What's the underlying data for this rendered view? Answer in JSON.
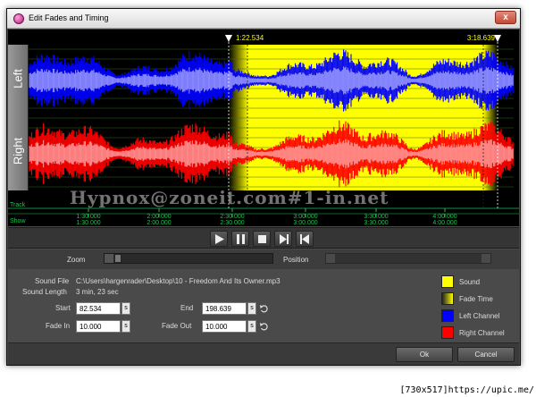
{
  "window": {
    "title": "Edit Fades and Timing",
    "close_glyph": "x"
  },
  "waveform": {
    "channels": [
      "Left",
      "Right"
    ],
    "start_marker": "1:22.534",
    "end_marker": "3:18.639",
    "track_label": "Track",
    "show_label": "Show",
    "track_ticks": [
      "1:30.000",
      "2:00.000",
      "2:30.000",
      "3:00.000",
      "3:30.000",
      "4:00.000"
    ],
    "show_ticks": [
      "1:30.000",
      "2:00.000",
      "2:30.000",
      "3:00.000",
      "3:30.000",
      "4:00.000"
    ],
    "colors": {
      "sound": "#ffff00",
      "left": "#0000ff",
      "right": "#ff0000",
      "grid": "#19c64a"
    }
  },
  "transport": {
    "buttons": [
      "play-icon",
      "pause-icon",
      "stop-icon",
      "play-from-icon",
      "rewind-icon"
    ]
  },
  "view": {
    "zoom_label": "Zoom",
    "position_label": "Position"
  },
  "info": {
    "sound_file_label": "Sound File",
    "sound_file_value": "C:\\Users\\hargenrader\\Desktop\\10 - Freedom And Its Owner.mp3",
    "sound_length_label": "Sound Length",
    "sound_length_value": "3 min, 23 sec"
  },
  "fields": {
    "start_label": "Start",
    "start_value": "82.534",
    "end_label": "End",
    "end_value": "198.639",
    "fade_in_label": "Fade In",
    "fade_in_value": "10.000",
    "fade_out_label": "Fade Out",
    "fade_out_value": "10.000",
    "unit": "s"
  },
  "legend": [
    {
      "label": "Sound",
      "color": "#ffff00"
    },
    {
      "label": "Fade Time",
      "color": "#ffff00"
    },
    {
      "label": "Left Channel",
      "color": "#0000ff"
    },
    {
      "label": "Right Channel",
      "color": "#ff0000"
    }
  ],
  "buttons": {
    "ok": "Ok",
    "cancel": "Cancel"
  },
  "watermark": "Hypnox@zoneit.com#1-in.net",
  "credit": "[730x517]https://upic.me/"
}
